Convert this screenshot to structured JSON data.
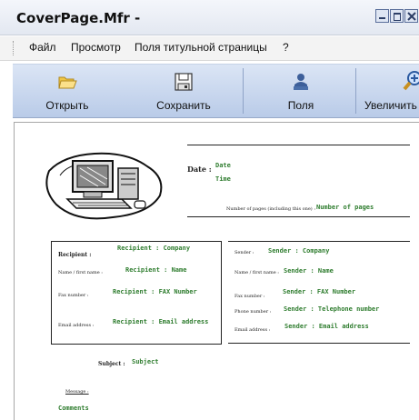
{
  "window": {
    "title": "CoverPage.Mfr -"
  },
  "menu": [
    "Файл",
    "Просмотр",
    "Поля титульной страницы",
    "?"
  ],
  "toolbar": {
    "buttons": [
      {
        "label": "Открыть",
        "icon": "folder-open-icon"
      },
      {
        "label": "Сохранить",
        "icon": "floppy-disk-icon"
      },
      {
        "label": "Поля",
        "icon": "user-fields-icon"
      },
      {
        "label": "Увеличить",
        "icon": "zoom-in-icon"
      }
    ]
  },
  "cover": {
    "date_label": "Date :",
    "date_field": "Date",
    "time_field": "Time",
    "pages_label": "Number of pages (including this one) :",
    "pages_field": "Number of pages",
    "recipient": {
      "heading": "Recipient :",
      "company": "Recipient : Company",
      "name_label": "Name / first name :",
      "name": "Recipient : Name",
      "fax_label": "Fax number :",
      "fax": "Recipient : FAX Number",
      "email_label": "Email address :",
      "email": "Recipient : Email address"
    },
    "sender": {
      "heading": "Sender :",
      "company": "Sender : Company",
      "name_label": "Name / first name :",
      "name": "Sender : Name",
      "fax_label": "Fax number :",
      "fax": "Sender : FAX Number",
      "phone_label": "Phone number :",
      "phone": "Sender : Telephone number",
      "email_label": "Email address :",
      "email": "Sender : Email address"
    },
    "subject_label": "Subject :",
    "subject": "Subject",
    "message_label": "Message :",
    "comments": "Comments"
  }
}
